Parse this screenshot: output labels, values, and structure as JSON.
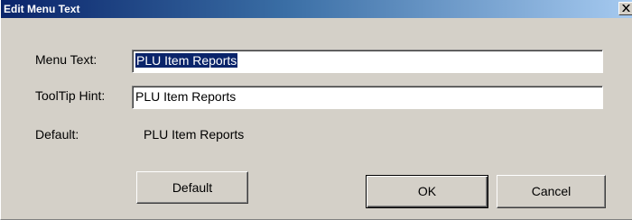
{
  "window": {
    "title": "Edit Menu Text",
    "close_icon": "close-icon"
  },
  "fields": {
    "menu_text_label": "Menu Text:",
    "menu_text_value": "PLU Item Reports",
    "tooltip_label": "ToolTip Hint:",
    "tooltip_value": "PLU Item Reports",
    "default_label": "Default:",
    "default_value": "PLU Item Reports"
  },
  "buttons": {
    "default_label": "Default",
    "ok_label": "OK",
    "cancel_label": "Cancel"
  },
  "colors": {
    "title_gradient_start": "#0a246a",
    "title_gradient_end": "#a6caf0",
    "dialog_background": "#d4d0c8",
    "selection_background": "#0a246a"
  }
}
